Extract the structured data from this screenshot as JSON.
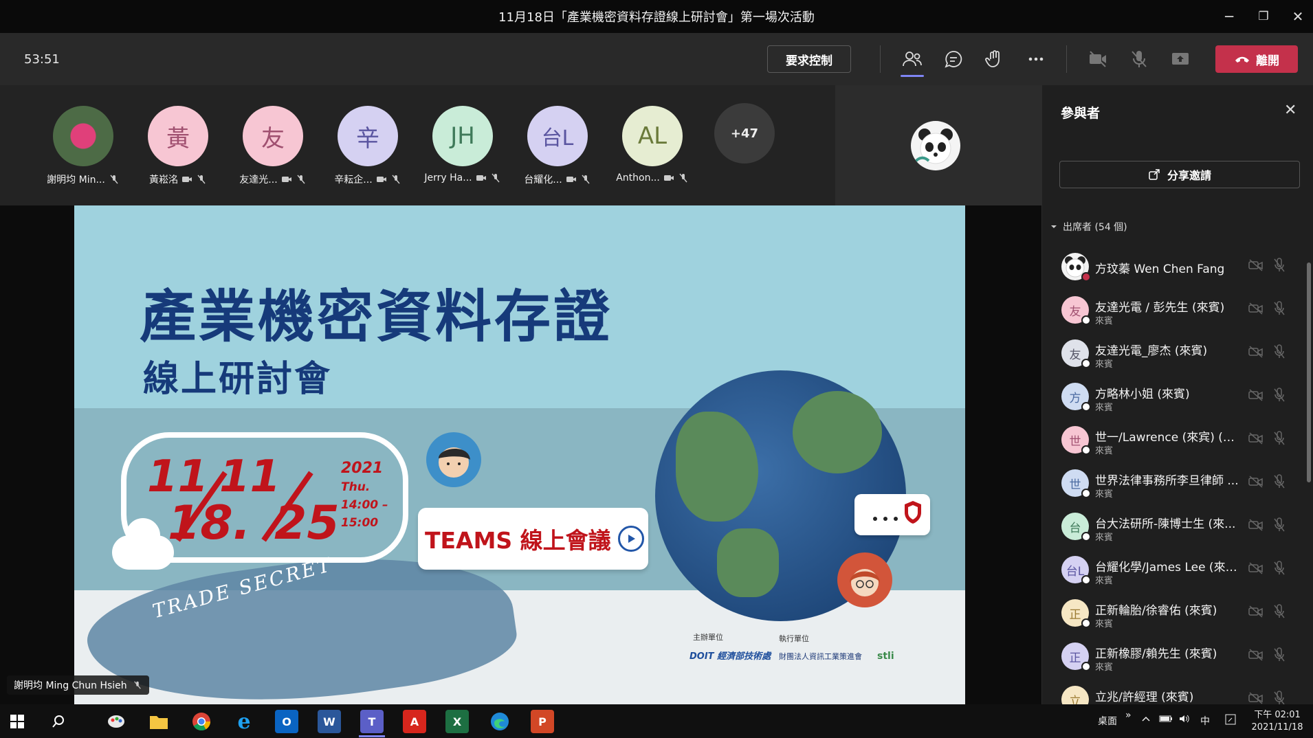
{
  "window": {
    "title": "11月18日「產業機密資料存證線上研討會」第一場次活動",
    "minimize": "─",
    "restore": "❐",
    "close": "✕"
  },
  "toolbar": {
    "timer": "53:51",
    "request_control": "要求控制",
    "leave": "離開",
    "icons": [
      "people-icon",
      "chat-icon",
      "raise-hand-icon",
      "more-icon",
      "camera-off-icon",
      "mic-off-icon",
      "share-icon"
    ]
  },
  "strip": {
    "participants": [
      {
        "initials": "",
        "name": "謝明均 Min...",
        "color": "#4d6b46"
      },
      {
        "initials": "黃",
        "name": "黃崧洺",
        "color": "#f7c6d3"
      },
      {
        "initials": "友",
        "name": "友達光...",
        "color": "#f7c6d3"
      },
      {
        "initials": "辛",
        "name": "辛耘企...",
        "color": "#d5d1f2"
      },
      {
        "initials": "JH",
        "name": "Jerry Ha...",
        "color": "#c9ecd8"
      },
      {
        "initials": "台L",
        "name": "台耀化...",
        "color": "#d5d1f2"
      },
      {
        "initials": "AL",
        "name": "Anthon...",
        "color": "#e6edd2"
      }
    ],
    "more": "+47"
  },
  "slide": {
    "title": "產業機密資料存證",
    "subtitle": "線上研討會",
    "date1": "11",
    "date2": "11",
    "date3": "18.",
    "date4": "25",
    "year": "2021",
    "day": "Thu.",
    "time_start": "14:00 –",
    "time_end": "15:00",
    "trade_secret": "TRADE SECRET",
    "teams": "TEAMS 線上會議",
    "organizer_label": "主辦單位",
    "executor_label": "執行單位",
    "logo1": "DOIT 經濟部技術處",
    "logo2": "財團法人資訊工業策進會",
    "logo3": "stli"
  },
  "presenter": "謝明均 Ming Chun Hsieh",
  "panel": {
    "title": "參與者",
    "share": "分享邀請",
    "section": "出席者 (54 個)",
    "people": [
      {
        "initial": "",
        "name": "方玟蓁 Wen Chen Fang",
        "role": "",
        "color": "#f2f2f2",
        "fg": "#333"
      },
      {
        "initial": "友",
        "name": "友達光電 / 彭先生 (來賓)",
        "role": "來賓",
        "color": "#f7c6d3",
        "fg": "#a05070"
      },
      {
        "initial": "友",
        "name": "友達光電_廖杰 (來賓)",
        "role": "來賓",
        "color": "#dfe2ea",
        "fg": "#556"
      },
      {
        "initial": "方",
        "name": "方略林小姐 (來賓)",
        "role": "來賓",
        "color": "#cfdcf2",
        "fg": "#4a6aa0"
      },
      {
        "initial": "世",
        "name": "世一/Lawrence (來宾) (來...",
        "role": "來賓",
        "color": "#f7c6d3",
        "fg": "#a05070"
      },
      {
        "initial": "世",
        "name": "世界法律事務所李旦律師 ...",
        "role": "來賓",
        "color": "#cfdcf2",
        "fg": "#4a6aa0"
      },
      {
        "initial": "台",
        "name": "台大法研所-陳博士生 (來...",
        "role": "來賓",
        "color": "#c9ecd8",
        "fg": "#3f7a5a"
      },
      {
        "initial": "台L",
        "name": "台耀化學/James Lee (來賓)",
        "role": "來賓",
        "color": "#d5d1f2",
        "fg": "#5a55a0"
      },
      {
        "initial": "正",
        "name": "正新輪胎/徐睿佑 (來賓)",
        "role": "來賓",
        "color": "#f6e7c4",
        "fg": "#9a7a30"
      },
      {
        "initial": "正",
        "name": "正新橡膠/賴先生 (來賓)",
        "role": "來賓",
        "color": "#d5d1f2",
        "fg": "#5a55a0"
      },
      {
        "initial": "立",
        "name": "立兆/許經理 (來賓)",
        "role": "來賓",
        "color": "#f6e7c4",
        "fg": "#9a7a30"
      }
    ]
  },
  "taskbar": {
    "desktop": "桌面",
    "chevron": "»",
    "ime": "中",
    "time": "下午 02:01",
    "date": "2021/11/18",
    "apps": [
      "windows-start",
      "search",
      "paint",
      "file-explorer",
      "chrome",
      "internet-explorer",
      "outlook",
      "word",
      "teams",
      "acrobat",
      "excel",
      "edge",
      "powerpoint"
    ]
  },
  "colors": {
    "leave": "#c4314b",
    "accent": "#7f85f5",
    "slide_title": "#163a7a",
    "slide_red": "#c0141b"
  }
}
